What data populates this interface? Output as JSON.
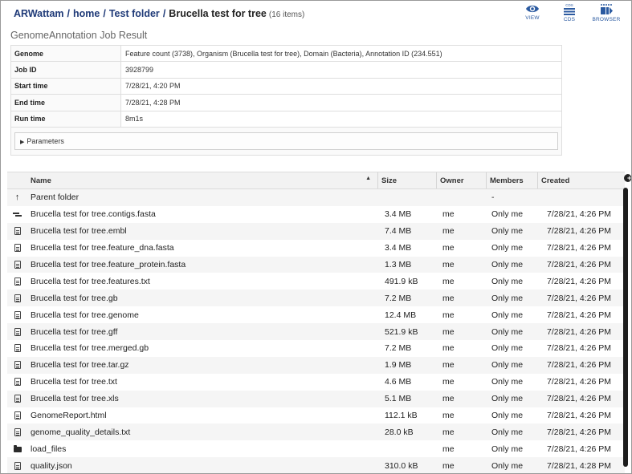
{
  "breadcrumb": {
    "parts": [
      "ARWattam",
      "home",
      "Test folder"
    ],
    "separator": "/",
    "current": "Brucella test for tree",
    "count": "(16 items)"
  },
  "actions": [
    {
      "label": "VIEW",
      "icon": "eye-icon"
    },
    {
      "label": "CDS",
      "icon": "cds-list-icon",
      "badge": "CDS"
    },
    {
      "label": "BROWSER",
      "icon": "genome-browser-icon"
    }
  ],
  "job": {
    "title": "GenomeAnnotation Job Result",
    "rows": [
      {
        "key": "Genome",
        "value": "Feature count (3738), Organism (Brucella test for tree), Domain (Bacteria), Annotation ID (234.551)"
      },
      {
        "key": "Job ID",
        "value": "3928799"
      },
      {
        "key": "Start time",
        "value": "7/28/21, 4:20 PM"
      },
      {
        "key": "End time",
        "value": "7/28/21, 4:28 PM"
      },
      {
        "key": "Run time",
        "value": "8m1s"
      }
    ],
    "parameters_label": "Parameters"
  },
  "grid": {
    "columns": [
      "Name",
      "Size",
      "Owner",
      "Members",
      "Created"
    ],
    "rows": [
      {
        "icon": "parent-folder-icon",
        "name": "Parent folder",
        "size": "",
        "owner": "",
        "members": "-",
        "created": ""
      },
      {
        "icon": "contigs-icon",
        "name": "Brucella test for tree.contigs.fasta",
        "size": "3.4 MB",
        "owner": "me",
        "members": "Only me",
        "created": "7/28/21, 4:26 PM"
      },
      {
        "icon": "file-icon",
        "name": "Brucella test for tree.embl",
        "size": "7.4 MB",
        "owner": "me",
        "members": "Only me",
        "created": "7/28/21, 4:26 PM"
      },
      {
        "icon": "file-icon",
        "name": "Brucella test for tree.feature_dna.fasta",
        "size": "3.4 MB",
        "owner": "me",
        "members": "Only me",
        "created": "7/28/21, 4:26 PM"
      },
      {
        "icon": "file-icon",
        "name": "Brucella test for tree.feature_protein.fasta",
        "size": "1.3 MB",
        "owner": "me",
        "members": "Only me",
        "created": "7/28/21, 4:26 PM"
      },
      {
        "icon": "file-icon",
        "name": "Brucella test for tree.features.txt",
        "size": "491.9 kB",
        "owner": "me",
        "members": "Only me",
        "created": "7/28/21, 4:26 PM"
      },
      {
        "icon": "file-icon",
        "name": "Brucella test for tree.gb",
        "size": "7.2 MB",
        "owner": "me",
        "members": "Only me",
        "created": "7/28/21, 4:26 PM"
      },
      {
        "icon": "file-icon",
        "name": "Brucella test for tree.genome",
        "size": "12.4 MB",
        "owner": "me",
        "members": "Only me",
        "created": "7/28/21, 4:26 PM"
      },
      {
        "icon": "file-icon",
        "name": "Brucella test for tree.gff",
        "size": "521.9 kB",
        "owner": "me",
        "members": "Only me",
        "created": "7/28/21, 4:26 PM"
      },
      {
        "icon": "file-icon",
        "name": "Brucella test for tree.merged.gb",
        "size": "7.2 MB",
        "owner": "me",
        "members": "Only me",
        "created": "7/28/21, 4:26 PM"
      },
      {
        "icon": "file-icon",
        "name": "Brucella test for tree.tar.gz",
        "size": "1.9 MB",
        "owner": "me",
        "members": "Only me",
        "created": "7/28/21, 4:26 PM"
      },
      {
        "icon": "file-icon",
        "name": "Brucella test for tree.txt",
        "size": "4.6 MB",
        "owner": "me",
        "members": "Only me",
        "created": "7/28/21, 4:26 PM"
      },
      {
        "icon": "file-icon",
        "name": "Brucella test for tree.xls",
        "size": "5.1 MB",
        "owner": "me",
        "members": "Only me",
        "created": "7/28/21, 4:26 PM"
      },
      {
        "icon": "file-icon",
        "name": "GenomeReport.html",
        "size": "112.1 kB",
        "owner": "me",
        "members": "Only me",
        "created": "7/28/21, 4:26 PM"
      },
      {
        "icon": "file-icon",
        "name": "genome_quality_details.txt",
        "size": "28.0 kB",
        "owner": "me",
        "members": "Only me",
        "created": "7/28/21, 4:26 PM"
      },
      {
        "icon": "folder-icon",
        "name": "load_files",
        "size": "",
        "owner": "me",
        "members": "Only me",
        "created": "7/28/21, 4:26 PM"
      },
      {
        "icon": "file-icon",
        "name": "quality.json",
        "size": "310.0 kB",
        "owner": "me",
        "members": "Only me",
        "created": "7/28/21, 4:28 PM"
      }
    ]
  },
  "colors": {
    "link": "#1f3a78",
    "action": "#2b5aa0",
    "row_alt": "#f5f5f5"
  }
}
